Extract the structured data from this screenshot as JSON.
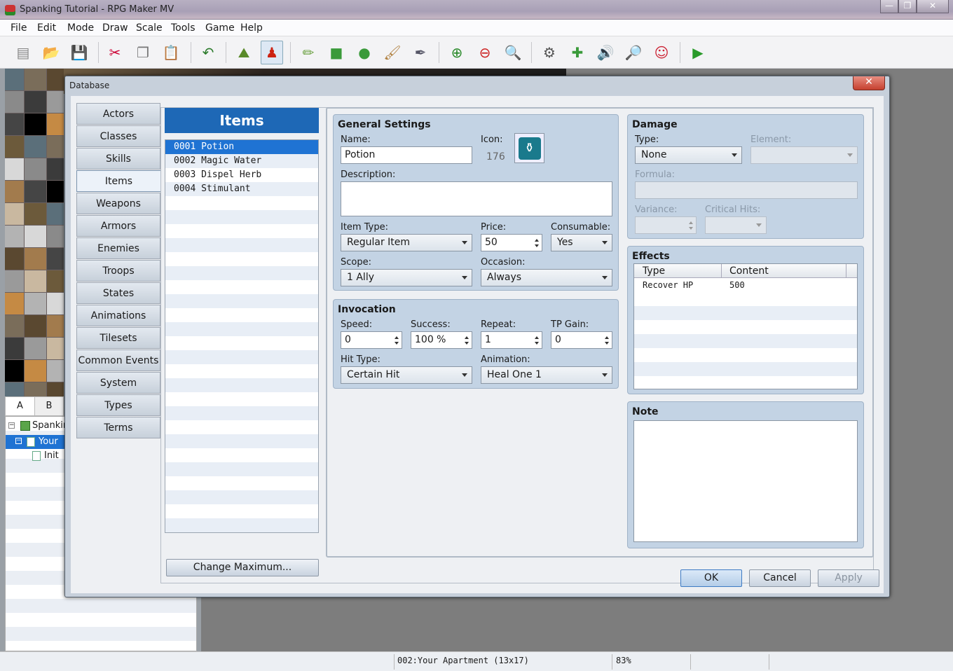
{
  "window": {
    "title": "Spanking Tutorial - RPG Maker MV"
  },
  "menu": [
    "File",
    "Edit",
    "Mode",
    "Draw",
    "Scale",
    "Tools",
    "Game",
    "Help"
  ],
  "toolbar": [
    {
      "name": "new-project-icon",
      "glyph": "▤"
    },
    {
      "name": "open-project-icon",
      "glyph": "📂"
    },
    {
      "name": "save-project-icon",
      "glyph": "💾"
    },
    {
      "name": "cut-icon",
      "glyph": "✂"
    },
    {
      "name": "copy-icon",
      "glyph": "❐"
    },
    {
      "name": "paste-icon",
      "glyph": "📋"
    },
    {
      "name": "undo-icon",
      "glyph": "↶"
    },
    {
      "name": "map-mode-icon",
      "glyph": "⛰"
    },
    {
      "name": "event-mode-icon",
      "glyph": "♟"
    },
    {
      "name": "pencil-icon",
      "glyph": "✏"
    },
    {
      "name": "rectangle-icon",
      "glyph": "■"
    },
    {
      "name": "ellipse-icon",
      "glyph": "●"
    },
    {
      "name": "flood-fill-icon",
      "glyph": "🖌"
    },
    {
      "name": "shadow-pen-icon",
      "glyph": "✒"
    },
    {
      "name": "zoom-in-icon",
      "glyph": "⊕"
    },
    {
      "name": "zoom-out-icon",
      "glyph": "⊖"
    },
    {
      "name": "actual-size-icon",
      "glyph": "🔍"
    },
    {
      "name": "database-icon",
      "glyph": "⚙"
    },
    {
      "name": "plugin-manager-icon",
      "glyph": "✚"
    },
    {
      "name": "sound-test-icon",
      "glyph": "🔊"
    },
    {
      "name": "event-searcher-icon",
      "glyph": "🔎"
    },
    {
      "name": "character-generator-icon",
      "glyph": "☺"
    },
    {
      "name": "playtest-icon",
      "glyph": "▶"
    }
  ],
  "colors": {
    "accent": "#1e68b6",
    "selection": "#1f73d3",
    "group": "#c3d3e4"
  },
  "left_panel": {
    "tabs": [
      "A",
      "B"
    ],
    "tree": [
      "Spankir",
      "Your",
      "Init"
    ]
  },
  "status": {
    "map": "002:Your Apartment (13x17)",
    "zoom": "83%"
  },
  "database": {
    "title": "Database",
    "categories": [
      "Actors",
      "Classes",
      "Skills",
      "Items",
      "Weapons",
      "Armors",
      "Enemies",
      "Troops",
      "States",
      "Animations",
      "Tilesets",
      "Common Events",
      "System",
      "Types",
      "Terms"
    ],
    "selected_category": "Items",
    "list_title": "Items",
    "items": [
      "0001 Potion",
      "0002 Magic Water",
      "0003 Dispel Herb",
      "0004 Stimulant"
    ],
    "change_max": "Change Maximum...",
    "general": {
      "title": "General Settings",
      "name_label": "Name:",
      "name": "Potion",
      "icon_label": "Icon:",
      "icon_index": "176",
      "desc_label": "Description:",
      "description": "",
      "item_type_label": "Item Type:",
      "item_type": "Regular Item",
      "price_label": "Price:",
      "price": "50",
      "consumable_label": "Consumable:",
      "consumable": "Yes",
      "scope_label": "Scope:",
      "scope": "1 Ally",
      "occasion_label": "Occasion:",
      "occasion": "Always"
    },
    "invocation": {
      "title": "Invocation",
      "speed_label": "Speed:",
      "speed": "0",
      "success_label": "Success:",
      "success": "100 %",
      "repeat_label": "Repeat:",
      "repeat": "1",
      "tp_label": "TP Gain:",
      "tp": "0",
      "hit_label": "Hit Type:",
      "hit": "Certain Hit",
      "anim_label": "Animation:",
      "anim": "Heal One 1"
    },
    "damage": {
      "title": "Damage",
      "type_label": "Type:",
      "type": "None",
      "element_label": "Element:",
      "element": "",
      "formula_label": "Formula:",
      "variance_label": "Variance:",
      "critical_label": "Critical Hits:"
    },
    "effects": {
      "title": "Effects",
      "col_type": "Type",
      "col_content": "Content",
      "rows": [
        {
          "type": "Recover HP",
          "content": "500"
        }
      ]
    },
    "note": {
      "title": "Note",
      "text": ""
    },
    "buttons": {
      "ok": "OK",
      "cancel": "Cancel",
      "apply": "Apply"
    }
  }
}
